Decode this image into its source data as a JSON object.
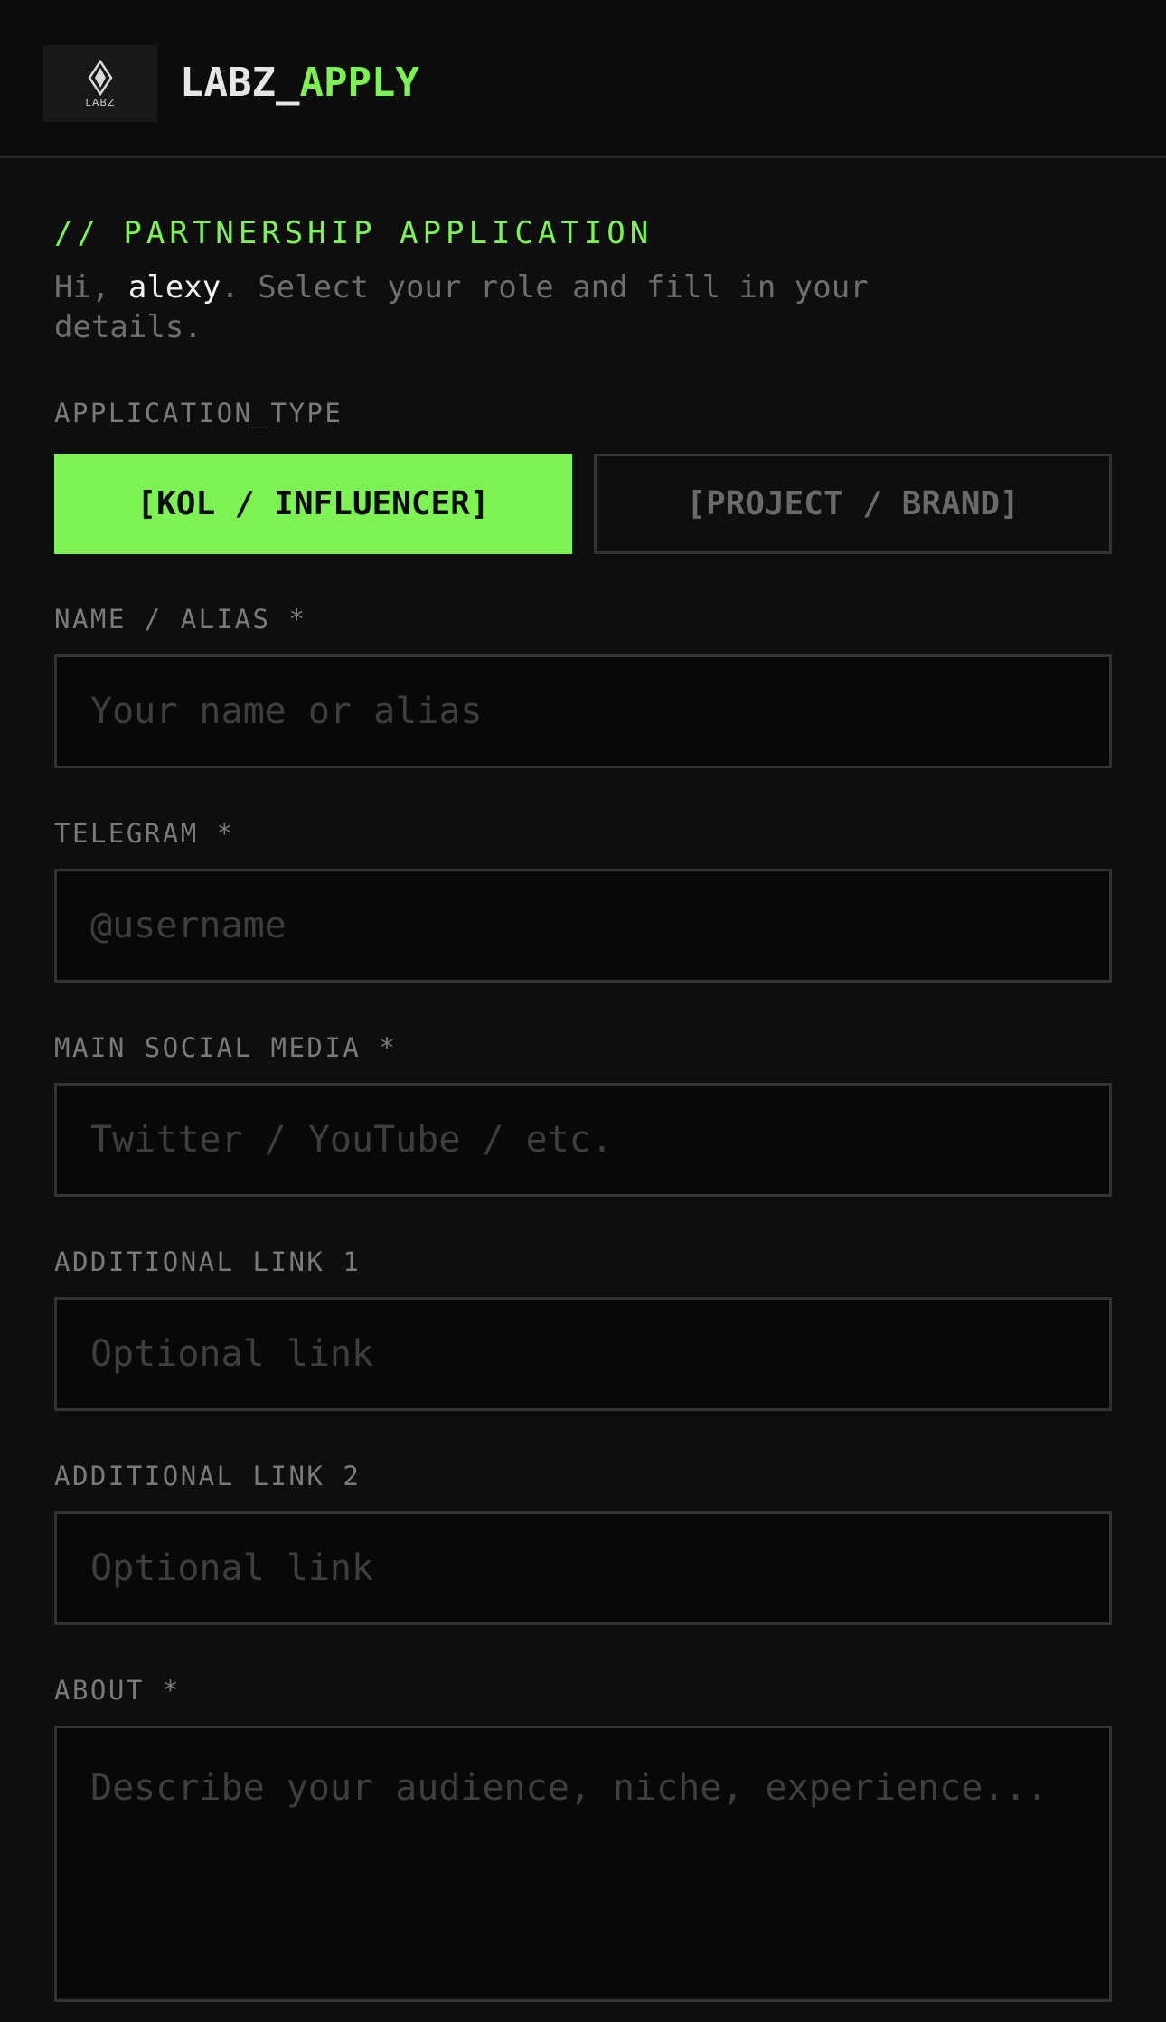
{
  "header": {
    "logo_text": "LABZ",
    "brand_part1": "LABZ_",
    "brand_part2": "APPLY"
  },
  "intro": {
    "section_title": "// PARTNERSHIP APPLICATION",
    "greeting_prefix": "Hi, ",
    "username": "alexy",
    "greeting_suffix": ". Select your role and fill in your details."
  },
  "application_type": {
    "label": "APPLICATION_TYPE",
    "options": [
      {
        "label": "[KOL / INFLUENCER]",
        "selected": true
      },
      {
        "label": "[PROJECT / BRAND]",
        "selected": false
      }
    ]
  },
  "fields": {
    "name": {
      "label": "NAME / ALIAS *",
      "placeholder": "Your name or alias",
      "value": ""
    },
    "telegram": {
      "label": "TELEGRAM *",
      "placeholder": "@username",
      "value": ""
    },
    "social": {
      "label": "MAIN SOCIAL MEDIA *",
      "placeholder": "Twitter / YouTube / etc.",
      "value": ""
    },
    "link1": {
      "label": "ADDITIONAL LINK 1",
      "placeholder": "Optional link",
      "value": ""
    },
    "link2": {
      "label": "ADDITIONAL LINK 2",
      "placeholder": "Optional link",
      "value": ""
    },
    "about": {
      "label": "ABOUT *",
      "placeholder": "Describe your audience, niche, experience...",
      "value": ""
    }
  },
  "colors": {
    "accent": "#7cf353",
    "background": "#0e0e0e",
    "input_background": "#080808",
    "border": "#333333",
    "muted_text": "#7a7a7a",
    "placeholder": "#3e3e3e"
  },
  "icons": {
    "logo": "labz-logo-icon"
  }
}
